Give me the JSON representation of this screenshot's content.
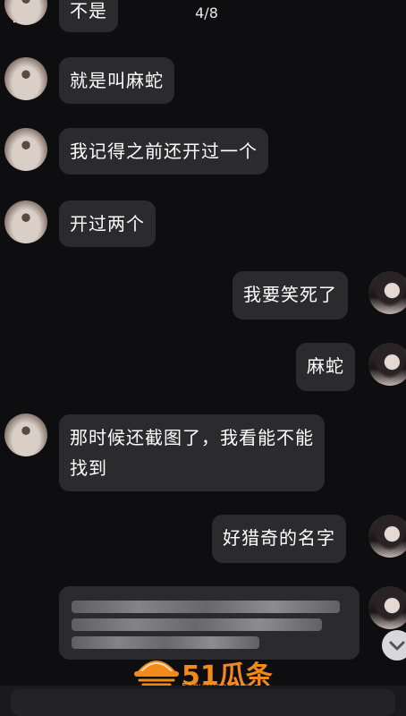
{
  "header": {
    "counter": "4/8"
  },
  "messages": [
    {
      "side": "left",
      "text": "不是"
    },
    {
      "side": "left",
      "text": "就是叫麻蛇"
    },
    {
      "side": "left",
      "text": "我记得之前还开过一个"
    },
    {
      "side": "left",
      "text": "开过两个"
    },
    {
      "side": "right",
      "text": "我要笑死了"
    },
    {
      "side": "right",
      "text": "麻蛇"
    },
    {
      "side": "left",
      "text_line1": "那时候还截图了，我看能不能",
      "text_line2": "找到"
    },
    {
      "side": "right",
      "text": "好猎奇的名字"
    }
  ],
  "watermark": {
    "brand": "51瓜条",
    "url": "51guatiao.com",
    "color": "#f28a1b"
  },
  "icons": {
    "close": "close-icon",
    "scroll_down": "chevron-down-icon"
  }
}
